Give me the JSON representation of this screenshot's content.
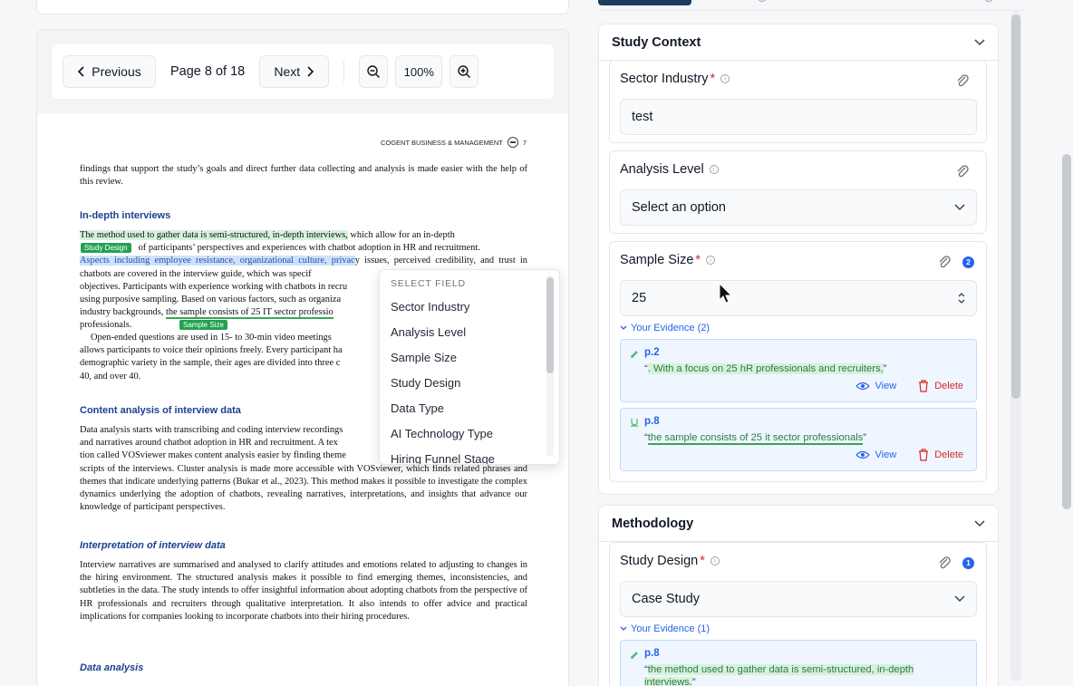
{
  "toolbar": {
    "prev_label": "Previous",
    "page_label": "Page 8 of 18",
    "next_label": "Next",
    "zoom": "100%"
  },
  "doc": {
    "header": "COGENT BUSINESS & MANAGEMENT",
    "page_num": "7",
    "p0": "findings that support the study’s goals and direct further data collecting and analysis is made easier with the help of this review.",
    "h1": "In-depth interviews",
    "p1_hl": "The method used to gather data is semi-structured, in-depth interviews,",
    "p1_a": " which allow for an in-depth",
    "p1_b": " of participants’ perspectives and experiences with chatbot adoption in HR and recruitment.",
    "p1_blue": "Aspects including employee resistance, organizational culture, privac",
    "p1_c": "y issues, perceived credibility, and trust in chatbots are covered in the interview guide, which was specif",
    "p1_d": " objectives. Participants with experience working with chatbots in recru",
    "p1_e": " using purposive sampling. Based on various factors, such as organiza",
    "p1_f": " industry backgrounds, ",
    "p1_ul": "the sample consists of 25 IT sector professio",
    "p1_g": " professionals.",
    "tag1": "Study Design",
    "tag2": "Sample Size",
    "p2": "Open-ended questions are used in 15- to 30-min video meetings",
    "p2_b": " allows participants to voice their opinions freely. Every participant ha",
    "p2_c": " demographic variety in the sample, their ages are divided into three c",
    "p2_d": " 40, and over 40.",
    "h2": "Content analysis of interview data",
    "p3": "Data analysis starts with transcribing and coding interview recordings",
    "p3_b": " and narratives around chatbot adoption in HR and recruitment. A tex",
    "p3_c": " tion called VOSviewer makes content analysis easier by finding theme",
    "p3_d": " scripts of the interviews. Cluster analysis is made more accessible with VOSviewer, which finds related phrases and themes that indicate underlying patterns (Bukar et al., 2023). This method makes it possible to investigate the complex dynamics underlying the adoption of chatbots, revealing narratives, interpretations, and insights that advance our knowledge of participant perspectives.",
    "h3": "Interpretation of interview data",
    "p4": "Interview narratives are summarised and analysed to clarify attitudes and emotions related to adjusting to changes in the hiring environment. The structured analysis makes it possible to find emerging themes, inconsistencies, and subtleties in the data. The study intends to offer insightful information about adopting chatbots from the perspective of HR professionals and recruiters through qualitative interpretation. It also intends to offer advice and practical implications for companies looking to incorporate chatbots into their hiring procedures.",
    "h4": "Data analysis"
  },
  "dropdown": {
    "title": "SELECT FIELD",
    "items": [
      "Sector Industry",
      "Analysis Level",
      "Sample Size",
      "Study Design",
      "Data Type",
      "AI Technology Type",
      "Hiring Funnel Stage"
    ]
  },
  "study_context": {
    "title": "Study Context",
    "sector": {
      "label": "Sector Industry",
      "value": "test"
    },
    "analysis": {
      "label": "Analysis Level",
      "placeholder": "Select an option"
    },
    "sample": {
      "label": "Sample Size",
      "value": "25",
      "badge": "2",
      "evidence_toggle": "Your Evidence (2)",
      "evidence": [
        {
          "page": "p.2",
          "quote": ". With a focus on 25 hR professionals and recruiters,"
        },
        {
          "page": "p.8",
          "quote": "the sample consists of 25 it sector professionals"
        }
      ]
    }
  },
  "methodology": {
    "title": "Methodology",
    "design": {
      "label": "Study Design",
      "value": "Case Study",
      "badge": "1",
      "evidence_toggle": "Your Evidence (1)",
      "evidence": [
        {
          "page": "p.8",
          "quote": "the method used to gather data is semi-structured, in-depth interviews."
        }
      ]
    }
  },
  "actions": {
    "view": "View",
    "delete": "Delete"
  },
  "colors": {
    "accent": "#2563eb",
    "danger": "#dc2626",
    "highlight": "#d6f1dc",
    "tag": "#22a251"
  }
}
